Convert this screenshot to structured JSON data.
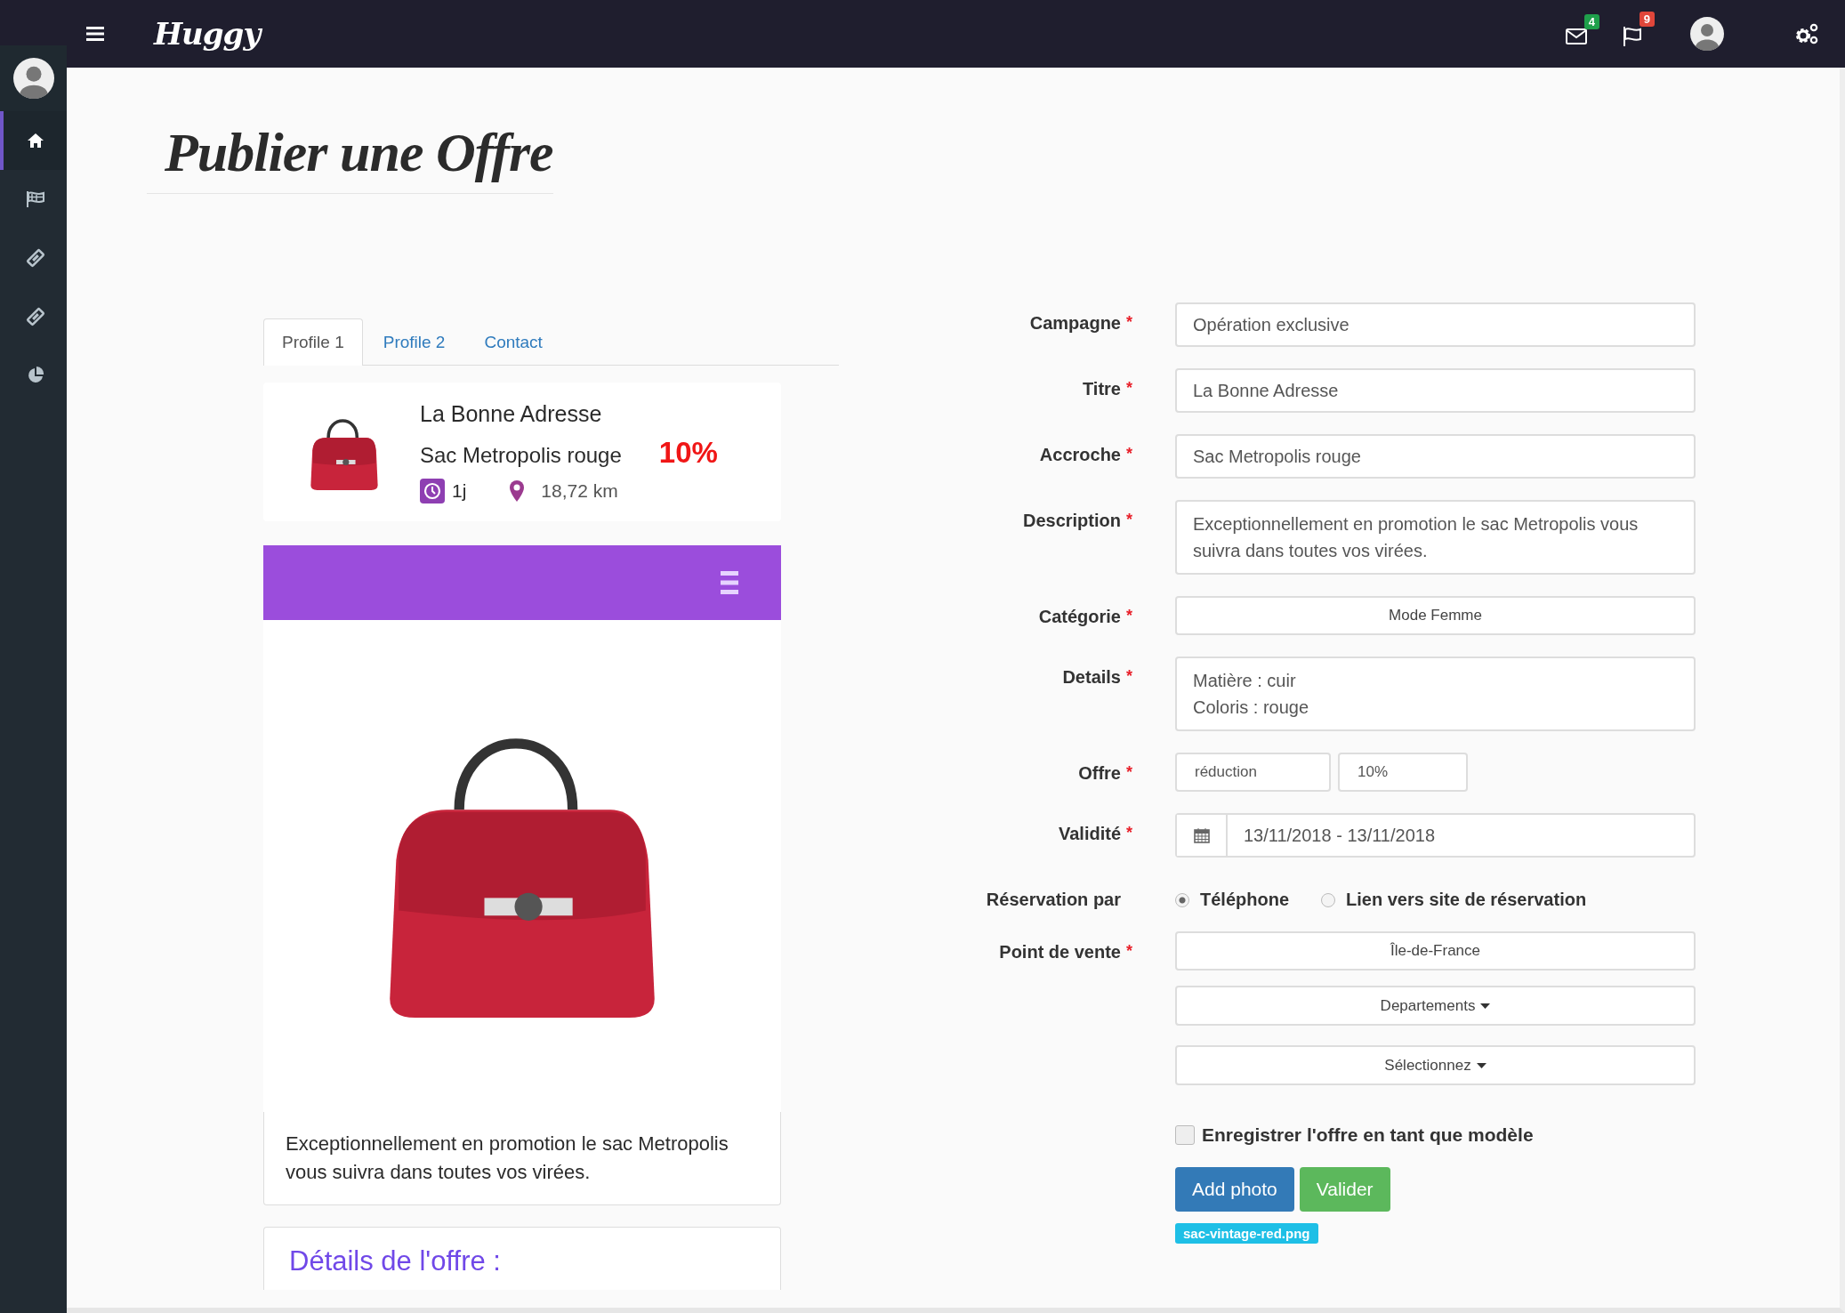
{
  "topbar": {
    "logo": "Huggy",
    "notifications": [
      {
        "kind": "mail",
        "count": "4",
        "color": "#1fa04b"
      },
      {
        "kind": "flag",
        "count": "9",
        "color": "#e0463a"
      }
    ]
  },
  "sidebar": {
    "items": [
      {
        "kind": "home",
        "selected": true
      },
      {
        "kind": "flag",
        "selected": false
      },
      {
        "kind": "ticket",
        "selected": false
      },
      {
        "kind": "ticket",
        "selected": false
      },
      {
        "kind": "pie",
        "selected": false
      }
    ]
  },
  "page_title": "Publier une Offre",
  "preview": {
    "tabs": [
      {
        "label": "Profile 1",
        "selected": true
      },
      {
        "label": "Profile 2",
        "selected": false
      },
      {
        "label": "Contact",
        "selected": false
      }
    ],
    "card": {
      "title": "La Bonne Adresse",
      "subtitle": "Sac Metropolis rouge",
      "discount": "10%",
      "duration": "1j",
      "distance": "18,72 km"
    },
    "description": "Exceptionnellement en promotion le sac Metropolis vous suivra dans toutes vos virées.",
    "details_heading": "Détails de l'offre :"
  },
  "form": {
    "rows": [
      {
        "label": "Campagne",
        "required_mark": "*",
        "kind": "text",
        "value": "Opération exclusive"
      },
      {
        "label": "Titre",
        "required_mark": "*",
        "kind": "text",
        "value": "La Bonne Adresse"
      },
      {
        "label": "Accroche",
        "required_mark": "*",
        "kind": "text",
        "value": "Sac Metropolis rouge"
      },
      {
        "label": "Description",
        "required_mark": "*",
        "kind": "textarea",
        "value": "Exceptionnellement en promotion le sac Metropolis vous suivra dans toutes vos virées."
      },
      {
        "label": "Catégorie",
        "required_mark": "*",
        "kind": "select",
        "value": "Mode Femme"
      },
      {
        "label": "Details",
        "required_mark": "*",
        "kind": "textarea",
        "value": "Matière : cuir\nColoris : rouge"
      },
      {
        "label": "Offre",
        "required_mark": "*",
        "kind": "pair",
        "values": [
          "réduction",
          "10%"
        ]
      },
      {
        "label": "Validité",
        "required_mark": "*",
        "kind": "daterange",
        "value": "13/11/2018 - 13/11/2018"
      },
      {
        "label": "Réservation par",
        "kind": "radio",
        "options": [
          {
            "label": "Téléphone",
            "selected": true
          },
          {
            "label": "Lien vers site de réservation",
            "selected": false
          }
        ]
      },
      {
        "label": "Point de vente",
        "required_mark": "*",
        "kind": "dropdowns",
        "items": [
          {
            "text": "Île-de-France",
            "caret": false
          },
          {
            "text": "Departements",
            "caret": true
          },
          {
            "text": "Sélectionnez",
            "caret": true
          }
        ]
      }
    ],
    "template_checkbox": {
      "label": "Enregistrer l'offre en tant que modèle",
      "checked": false
    },
    "buttons": [
      {
        "label": "Add photo",
        "kind": "primary"
      },
      {
        "label": "Valider",
        "kind": "success"
      }
    ],
    "file_tag": "sac-vintage-red.png"
  }
}
